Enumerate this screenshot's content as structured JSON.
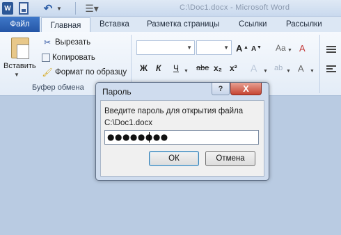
{
  "quick_access": {
    "app_icon_letter": "W",
    "document_title": "С:\\Doc1.docx - Microsoft Word"
  },
  "tabs": [
    "Файл",
    "Главная",
    "Вставка",
    "Разметка страницы",
    "Ссылки",
    "Рассылки"
  ],
  "clipboard_group": {
    "paste_label": "Вставить",
    "cut_label": "Вырезать",
    "copy_label": "Копировать",
    "format_painter_label": "Формат по образцу",
    "group_label": "Буфер обмена"
  },
  "font_group": {
    "grow_font": "A",
    "shrink_font": "A",
    "change_case": "Aa",
    "clear_formatting": "A",
    "bold": "Ж",
    "italic": "К",
    "underline": "Ч",
    "strikethrough": "abe",
    "subscript": "x₂",
    "superscript": "x²",
    "text_effects": "A",
    "highlight": "ab",
    "font_color": "A"
  },
  "dialog": {
    "title": "Пароль",
    "help_symbol": "?",
    "close_symbol": "X",
    "prompt": "Введите пароль для открытия файла",
    "file_path": "C:\\Doc1.docx",
    "password_masked": "●●●●●●●●",
    "ok_label": "ОК",
    "cancel_label": "Отмена"
  },
  "colors": {
    "file_tab": "#2f64b7",
    "background": "#b9cbe2",
    "close_button": "#c64533"
  }
}
